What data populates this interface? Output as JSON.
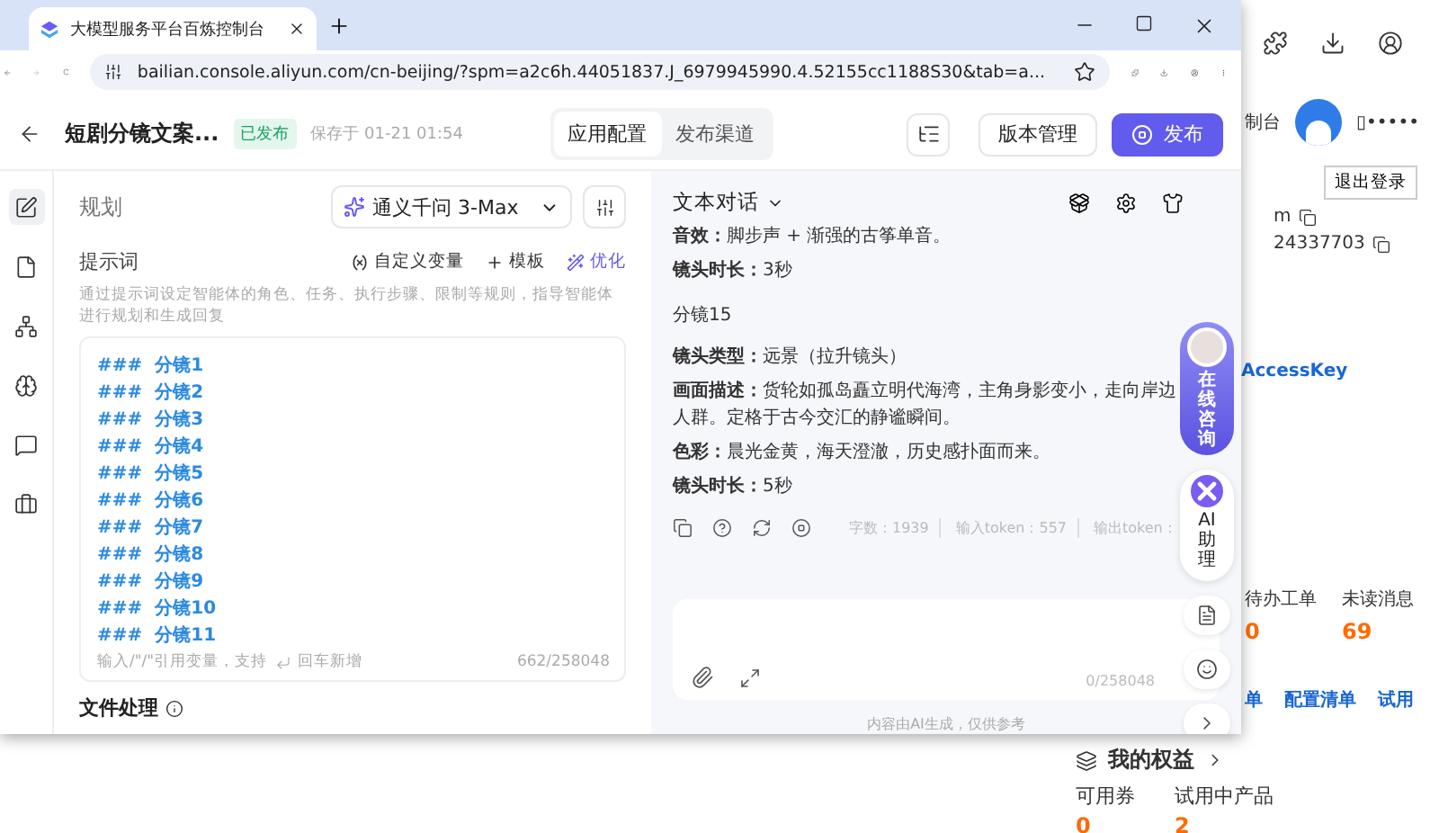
{
  "browser": {
    "tab_title": "大模型服务平台百炼控制台",
    "url": "bailian.console.aliyun.com/cn-beijing/?spm=a2c6h.44051837.J_6979945990.4.52155cc1188S30&tab=a..."
  },
  "app_header": {
    "title": "短剧分镜文案...",
    "status": "已发布",
    "saved": "保存于 01-21 01:54",
    "tabs": [
      {
        "label": "应用配置",
        "selected": true
      },
      {
        "label": "发布渠道",
        "selected": false
      }
    ],
    "version_button": "版本管理",
    "publish_button": "发布"
  },
  "rail": [
    {
      "selected": true
    },
    {
      "selected": false
    },
    {
      "selected": false
    },
    {
      "selected": false
    },
    {
      "selected": false
    },
    {
      "selected": false
    }
  ],
  "planning": {
    "title": "规划",
    "model": "通义千问 3-Max",
    "prompt_label": "提示词",
    "actions": [
      {
        "label": "自定义变量",
        "highlight": false
      },
      {
        "label": "模板",
        "highlight": false
      },
      {
        "label": "优化",
        "highlight": true
      }
    ],
    "hint": "通过提示词设定智能体的角色、任务、执行步骤、限制等规则，指导智能体进行规划和生成回复",
    "prompt_lines": [
      {
        "mark": "###",
        "text": "分镜1"
      },
      {
        "mark": "###",
        "text": "分镜2"
      },
      {
        "mark": "###",
        "text": "分镜3"
      },
      {
        "mark": "###",
        "text": "分镜4"
      },
      {
        "mark": "###",
        "text": "分镜5"
      },
      {
        "mark": "###",
        "text": "分镜6"
      },
      {
        "mark": "###",
        "text": "分镜7"
      },
      {
        "mark": "###",
        "text": "分镜8"
      },
      {
        "mark": "###",
        "text": "分镜9"
      },
      {
        "mark": "###",
        "text": "分镜10"
      },
      {
        "mark": "###",
        "text": "分镜11"
      }
    ],
    "footer_hint_start": "输入/\"/\"引用变量，支持",
    "footer_hint_end": "回车新增",
    "counter": "662/258048",
    "next_section": "文件处理"
  },
  "chat": {
    "title": "文本对话",
    "messages": [
      {
        "kind": "field",
        "label": "音效：",
        "text": "脚步声 + 渐强的古筝单音。"
      },
      {
        "kind": "field",
        "label": "镜头时长：",
        "text": "3秒"
      },
      {
        "kind": "heading",
        "text": "分镜15"
      },
      {
        "kind": "field",
        "label": "镜头类型：",
        "text": "远景（拉升镜头）"
      },
      {
        "kind": "field",
        "label": "画面描述：",
        "text": "货轮如孤岛矗立明代海湾，主角身影变小，走向岸边人群。定格于古今交汇的静谧瞬间。"
      },
      {
        "kind": "field",
        "label": "色彩：",
        "text": "晨光金黄，海天澄澈，历史感扑面而来。"
      },
      {
        "kind": "field",
        "label": "镜头时长：",
        "text": "5秒"
      }
    ],
    "stats": [
      "字数：1939",
      "输入token：557",
      "输出token："
    ],
    "input_counter": "0/258048",
    "disclaimer": "内容由AI生成，仅供参考"
  },
  "float_widget": {
    "consult": "在线咨询",
    "assistant": "AI助理"
  },
  "back_page": {
    "console_link": "制台",
    "user": "▯•••••",
    "logout": "退出登录",
    "account_name": "m",
    "account_id": "24337703",
    "access_key": "AccessKey",
    "counters": [
      {
        "label": "待办工单",
        "value": "0"
      },
      {
        "label": "未读消息",
        "value": "69"
      }
    ],
    "links": [
      "单",
      "配置清单",
      "试用"
    ],
    "benefits_title": "我的权益",
    "benefits": [
      {
        "label": "可用券",
        "value": "0"
      },
      {
        "label": "试用中产品",
        "value": "2"
      }
    ]
  }
}
